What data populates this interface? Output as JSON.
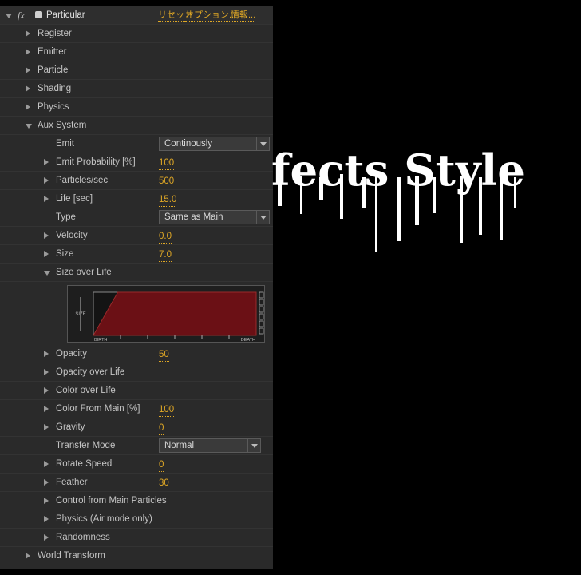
{
  "header": {
    "fx_label": "fx",
    "plugin_name": "Particular",
    "reset_link": "リセット",
    "options_link": "オプション...",
    "about_link": "情報..."
  },
  "rows": [
    {
      "label": "Register",
      "level": 1,
      "state": "collapsed"
    },
    {
      "label": "Emitter",
      "level": 1,
      "state": "collapsed"
    },
    {
      "label": "Particle",
      "level": 1,
      "state": "collapsed"
    },
    {
      "label": "Shading",
      "level": 1,
      "state": "collapsed"
    },
    {
      "label": "Physics",
      "level": 1,
      "state": "collapsed"
    },
    {
      "label": "Aux System",
      "level": 1,
      "state": "expanded"
    },
    {
      "label": "Emit",
      "level": 2,
      "state": "none",
      "dropdown": "Continously"
    },
    {
      "label": "Emit Probability [%]",
      "level": 2,
      "state": "collapsed",
      "value": "100"
    },
    {
      "label": "Particles/sec",
      "level": 2,
      "state": "collapsed",
      "value": "500"
    },
    {
      "label": "Life [sec]",
      "level": 2,
      "state": "collapsed",
      "value": "15.0"
    },
    {
      "label": "Type",
      "level": 2,
      "state": "none",
      "dropdown": "Same as Main"
    },
    {
      "label": "Velocity",
      "level": 2,
      "state": "collapsed",
      "value": "0.0"
    },
    {
      "label": "Size",
      "level": 2,
      "state": "collapsed",
      "value": "7.0"
    },
    {
      "label": "Size over Life",
      "level": 2,
      "state": "expanded",
      "graph": true
    },
    {
      "label": "Opacity",
      "level": 2,
      "state": "collapsed",
      "value": "50"
    },
    {
      "label": "Opacity over Life",
      "level": 2,
      "state": "collapsed"
    },
    {
      "label": "Color over Life",
      "level": 2,
      "state": "collapsed"
    },
    {
      "label": "Color From Main [%]",
      "level": 2,
      "state": "collapsed",
      "value": "100"
    },
    {
      "label": "Gravity",
      "level": 2,
      "state": "collapsed",
      "value": "0"
    },
    {
      "label": "Transfer Mode",
      "level": 2,
      "state": "none",
      "dropdown": "Normal"
    },
    {
      "label": "Rotate Speed",
      "level": 2,
      "state": "collapsed",
      "value": "0"
    },
    {
      "label": "Feather",
      "level": 2,
      "state": "collapsed",
      "value": "30"
    },
    {
      "label": "Control from Main Particles",
      "level": 2,
      "state": "collapsed"
    },
    {
      "label": "Physics (Air mode only)",
      "level": 2,
      "state": "collapsed"
    },
    {
      "label": "Randomness",
      "level": 2,
      "state": "collapsed"
    },
    {
      "label": "World Transform",
      "level": 1,
      "state": "collapsed"
    }
  ],
  "size_graph": {
    "y_label": "SIZE",
    "x_start_label": "BIRTH",
    "x_end_label": "DEATH",
    "fill_color": "#6b1015",
    "curve": [
      [
        0,
        0
      ],
      [
        0.15,
        1
      ],
      [
        1,
        1
      ]
    ]
  },
  "artwork_text": "fects Style",
  "colors": {
    "value_accent": "#e0a825",
    "panel_bg": "#2a2a2a",
    "canvas_bg": "#000000"
  }
}
